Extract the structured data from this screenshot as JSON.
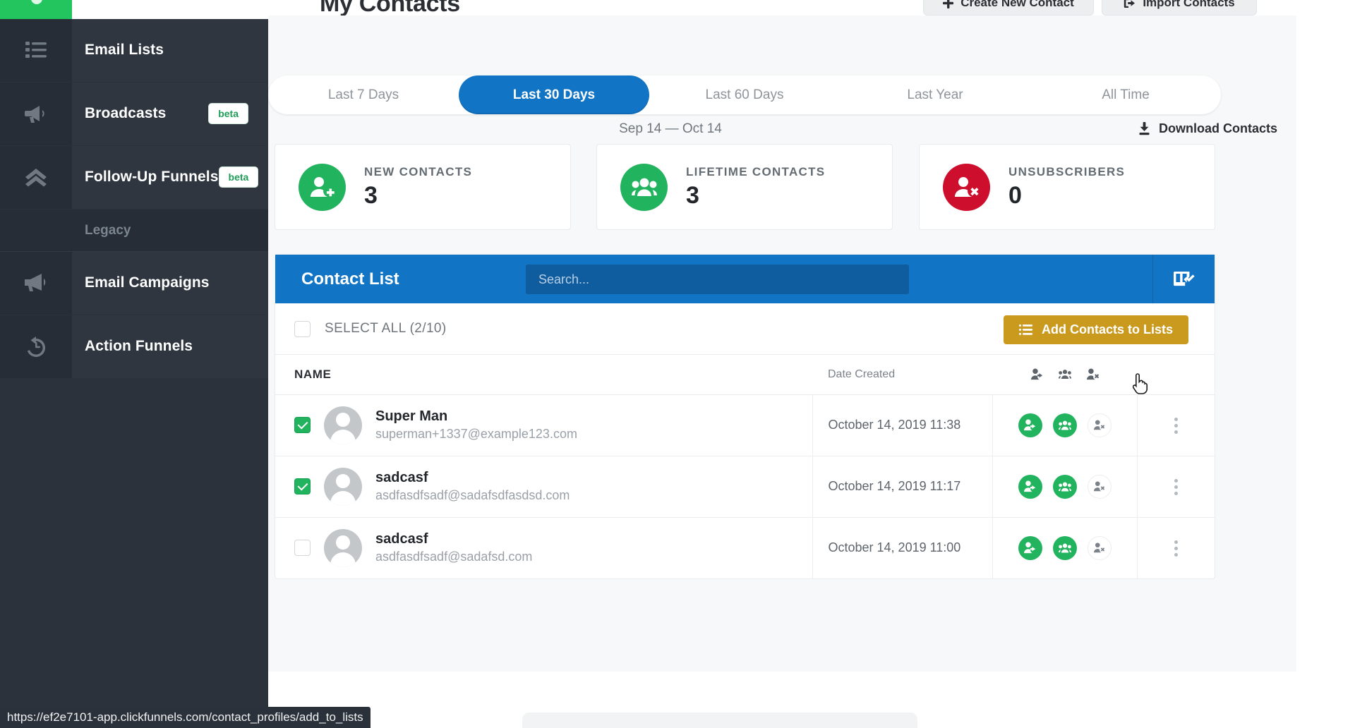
{
  "sidebar": {
    "items": [
      {
        "label": "Email Lists",
        "icon": "list-icon",
        "badge": ""
      },
      {
        "label": "Broadcasts",
        "icon": "megaphone-outline-icon",
        "badge": "beta"
      },
      {
        "label": "Follow-Up Funnels",
        "icon": "double-chevron-up-icon",
        "badge": "beta"
      }
    ],
    "legacy_label": "Legacy",
    "legacy_items": [
      {
        "label": "Email Campaigns",
        "icon": "megaphone-solid-icon",
        "badge": ""
      },
      {
        "label": "Action Funnels",
        "icon": "history-clock-icon",
        "badge": ""
      }
    ]
  },
  "header": {
    "title": "My Contacts",
    "create_button": "Create New Contact",
    "create_icon": "plus-icon",
    "import_button": "Import Contacts",
    "import_icon": "import-arrow-icon"
  },
  "filters": {
    "options": [
      "Last 7 Days",
      "Last 30 Days",
      "Last 60 Days",
      "Last Year",
      "All Time"
    ],
    "active": "Last 30 Days",
    "active_index": 1
  },
  "date_range": "Sep 14 — Oct 14",
  "download": {
    "label": "Download Contacts",
    "icon": "download-icon"
  },
  "stats": [
    {
      "label": "NEW CONTACTS",
      "value": "3",
      "icon": "user-plus-icon",
      "color": "#22b35e"
    },
    {
      "label": "LIFETIME CONTACTS",
      "value": "3",
      "icon": "users-icon",
      "color": "#22b35e"
    },
    {
      "label": "UNSUBSCRIBERS",
      "value": "0",
      "icon": "user-x-icon",
      "color": "#ce0e2d"
    }
  ],
  "contact_list": {
    "title": "Contact List",
    "search_placeholder": "Search...",
    "search_value": "",
    "columns_icon": "columns-check-icon",
    "select_all_label": "SELECT ALL (2/10)",
    "select_all_checked": false,
    "add_to_lists_label": "Add Contacts to Lists",
    "add_to_lists_icon": "list-lines-icon",
    "columns": {
      "name": "NAME",
      "date_created": "Date Created",
      "icons": [
        "user-arrow-icon",
        "users-icon",
        "user-x-icon"
      ]
    },
    "rows": [
      {
        "checked": true,
        "avatar": "avatar-placeholder",
        "name": "Super Man",
        "email": "superman+1337@example123.com",
        "date_created": "October 14, 2019 11:38",
        "actions": [
          {
            "icon": "user-arrow-icon",
            "state": "active"
          },
          {
            "icon": "users-icon",
            "state": "active"
          },
          {
            "icon": "user-x-icon",
            "state": "inactive"
          }
        ],
        "menu_icon": "kebab-menu-icon"
      },
      {
        "checked": true,
        "avatar": "avatar-placeholder",
        "name": "sadcasf",
        "email": "asdfasdfsadf@sadafsdfasdsd.com",
        "date_created": "October 14, 2019 11:17",
        "actions": [
          {
            "icon": "user-arrow-icon",
            "state": "active"
          },
          {
            "icon": "users-icon",
            "state": "active"
          },
          {
            "icon": "user-x-icon",
            "state": "inactive"
          }
        ],
        "menu_icon": "kebab-menu-icon"
      },
      {
        "checked": false,
        "avatar": "avatar-placeholder",
        "name": "sadcasf",
        "email": "asdfasdfsadf@sadafsd.com",
        "date_created": "October 14, 2019 11:00",
        "actions": [
          {
            "icon": "user-arrow-icon",
            "state": "active"
          },
          {
            "icon": "users-icon",
            "state": "active"
          },
          {
            "icon": "user-x-icon",
            "state": "inactive"
          }
        ],
        "menu_icon": "kebab-menu-icon"
      }
    ]
  },
  "status_bar": {
    "url": "https://ef2e7101-app.clickfunnels.com/contact_profiles/add_to_lists"
  },
  "colors": {
    "sidebar_bg": "#2b323b",
    "accent_blue": "#1274c4",
    "accent_green": "#22b35e",
    "accent_red": "#ce0e2d",
    "accent_gold": "#c99a1e",
    "brand_green": "#22c55e"
  }
}
